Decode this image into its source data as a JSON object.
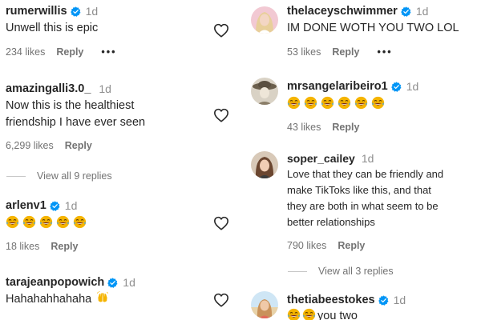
{
  "left": {
    "comments": [
      {
        "username": "rumerwillis",
        "verified": true,
        "time": "1d",
        "text": "Unwell this is epic",
        "likes": "234 likes",
        "reply": "Reply",
        "more": "•••"
      },
      {
        "username": "amazingalli3.0_",
        "verified": false,
        "time": "1d",
        "text_line1": "Now this is the healthiest",
        "text_line2": "friendship I have ever seen",
        "likes": "6,299 likes",
        "reply": "Reply",
        "view_replies": "View all 9 replies"
      },
      {
        "username": "arlenv1",
        "verified": true,
        "time": "1d",
        "emoji_count": 5,
        "emoji": "laughing-with-tears",
        "likes": "18 likes",
        "reply": "Reply"
      },
      {
        "username": "tarajeanpopowich",
        "verified": true,
        "time": "1d",
        "text": "Hahahahhahaha",
        "trailing_emoji": "raised-hands"
      }
    ]
  },
  "right": {
    "comments": [
      {
        "username": "thelaceyschwimmer",
        "verified": true,
        "time": "1d",
        "text": "IM DONE WOTH YOU TWO LOL",
        "likes": "53 likes",
        "reply": "Reply",
        "more": "•••"
      },
      {
        "username": "mrsangelaribeiro1",
        "verified": true,
        "time": "1d",
        "emoji_count": 6,
        "emoji": "laughing-with-tears",
        "likes": "43 likes",
        "reply": "Reply"
      },
      {
        "username": "soper_cailey",
        "verified": false,
        "time": "1d",
        "text_line1": "Love that they can be friendly and",
        "text_line2": "make TikToks like this, and that",
        "text_line3": "they are both in what seem to be",
        "text_line4": "better relationships",
        "likes": "790 likes",
        "reply": "Reply",
        "view_replies": "View all 3 replies"
      },
      {
        "username": "thetiabeestokes",
        "verified": true,
        "time": "1d",
        "emoji_count": 2,
        "text_after": "you two"
      }
    ]
  },
  "colors": {
    "verified": "#0095f6",
    "text": "#262626",
    "muted": "#737373",
    "emoji": "#f5b400"
  }
}
